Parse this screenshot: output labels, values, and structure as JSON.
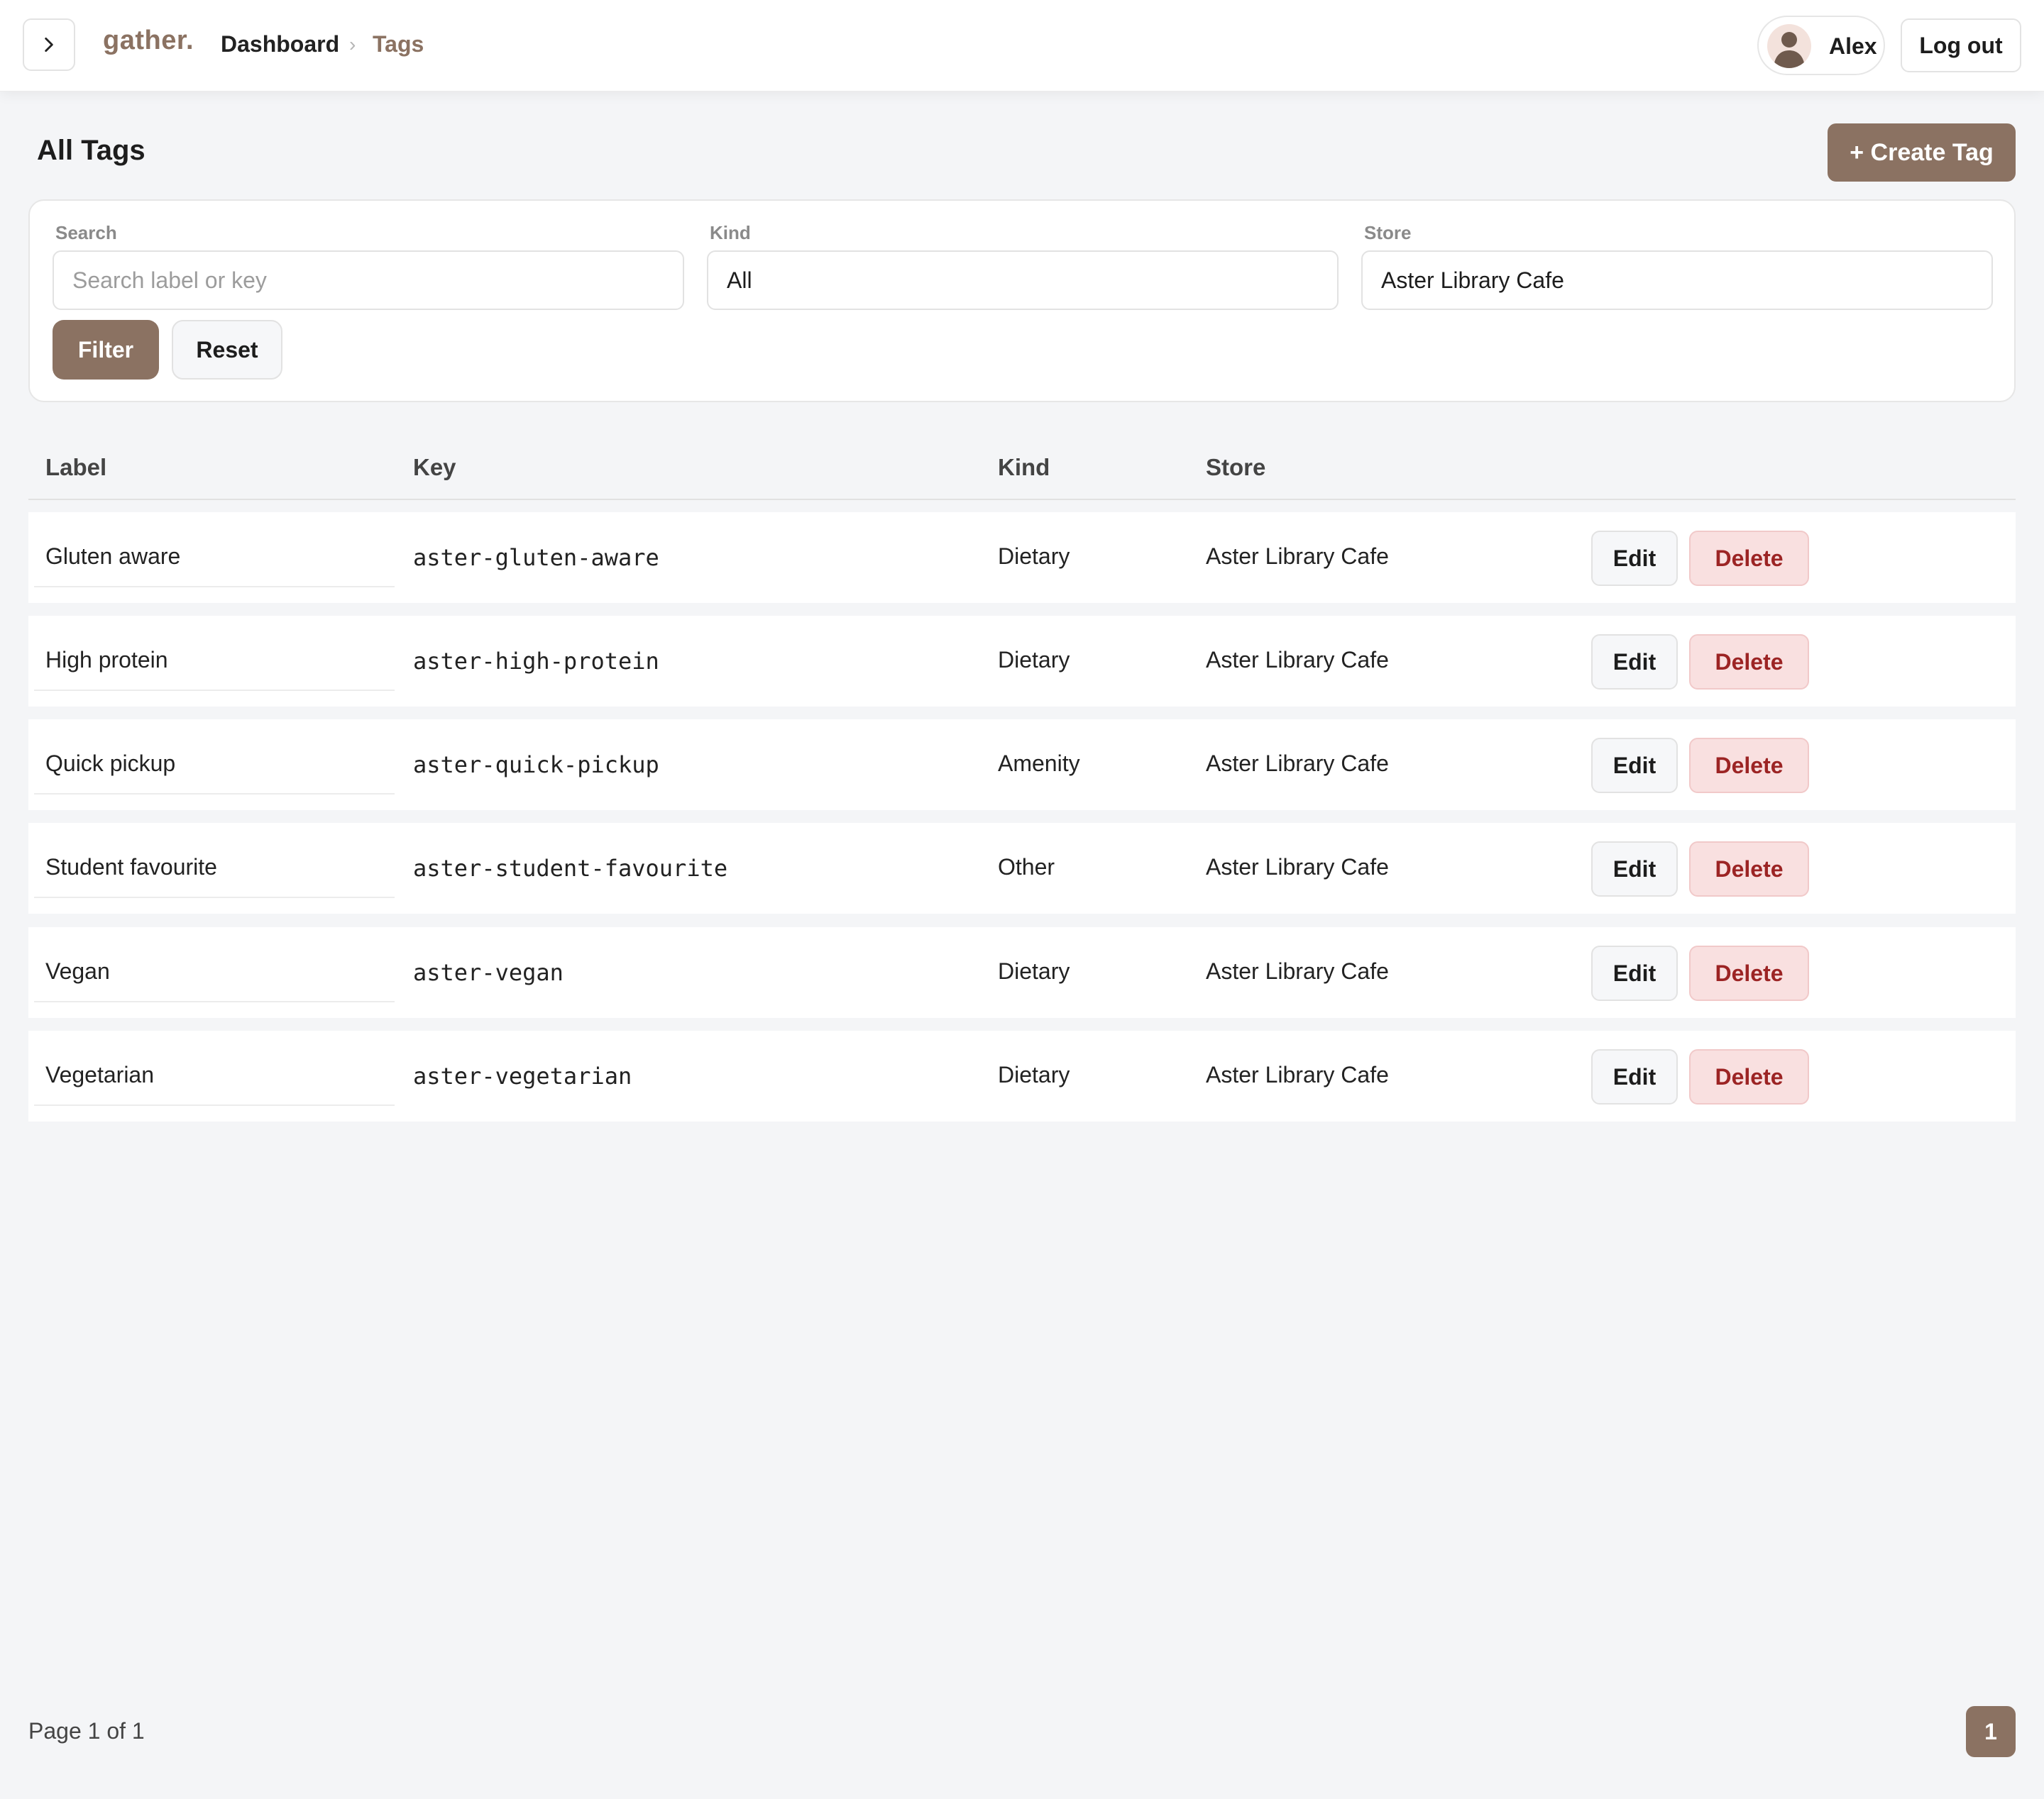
{
  "header": {
    "logo": "gather.",
    "breadcrumb": {
      "first": "Dashboard",
      "separator": "›",
      "current": "Tags"
    },
    "user_name": "Alex",
    "logout_label": "Log out"
  },
  "page": {
    "title": "All Tags",
    "create_label": "+ Create Tag"
  },
  "filters": {
    "search_label": "Search",
    "search_placeholder": "Search label or key",
    "kind_label": "Kind",
    "kind_value": "All",
    "store_label": "Store",
    "store_value": "Aster Library Cafe",
    "filter_label": "Filter",
    "reset_label": "Reset"
  },
  "table": {
    "headers": {
      "label": "Label",
      "key": "Key",
      "kind": "Kind",
      "store": "Store"
    },
    "edit_label": "Edit",
    "delete_label": "Delete",
    "rows": [
      {
        "label": "Gluten aware",
        "key": "aster-gluten-aware",
        "kind": "Dietary",
        "store": "Aster Library Cafe"
      },
      {
        "label": "High protein",
        "key": "aster-high-protein",
        "kind": "Dietary",
        "store": "Aster Library Cafe"
      },
      {
        "label": "Quick pickup",
        "key": "aster-quick-pickup",
        "kind": "Amenity",
        "store": "Aster Library Cafe"
      },
      {
        "label": "Student favourite",
        "key": "aster-student-favourite",
        "kind": "Other",
        "store": "Aster Library Cafe"
      },
      {
        "label": "Vegan",
        "key": "aster-vegan",
        "kind": "Dietary",
        "store": "Aster Library Cafe"
      },
      {
        "label": "Vegetarian",
        "key": "aster-vegetarian",
        "kind": "Dietary",
        "store": "Aster Library Cafe"
      }
    ]
  },
  "pagination": {
    "info": "Page 1 of 1",
    "current_page": "1"
  },
  "colors": {
    "brand": "#8b7262",
    "danger_text": "#9c2424",
    "danger_bg": "#f9e0e0",
    "background": "#f4f5f7"
  },
  "icons": {
    "sidebar_toggle": "chevron-right-icon",
    "avatar": "user-avatar-icon"
  }
}
